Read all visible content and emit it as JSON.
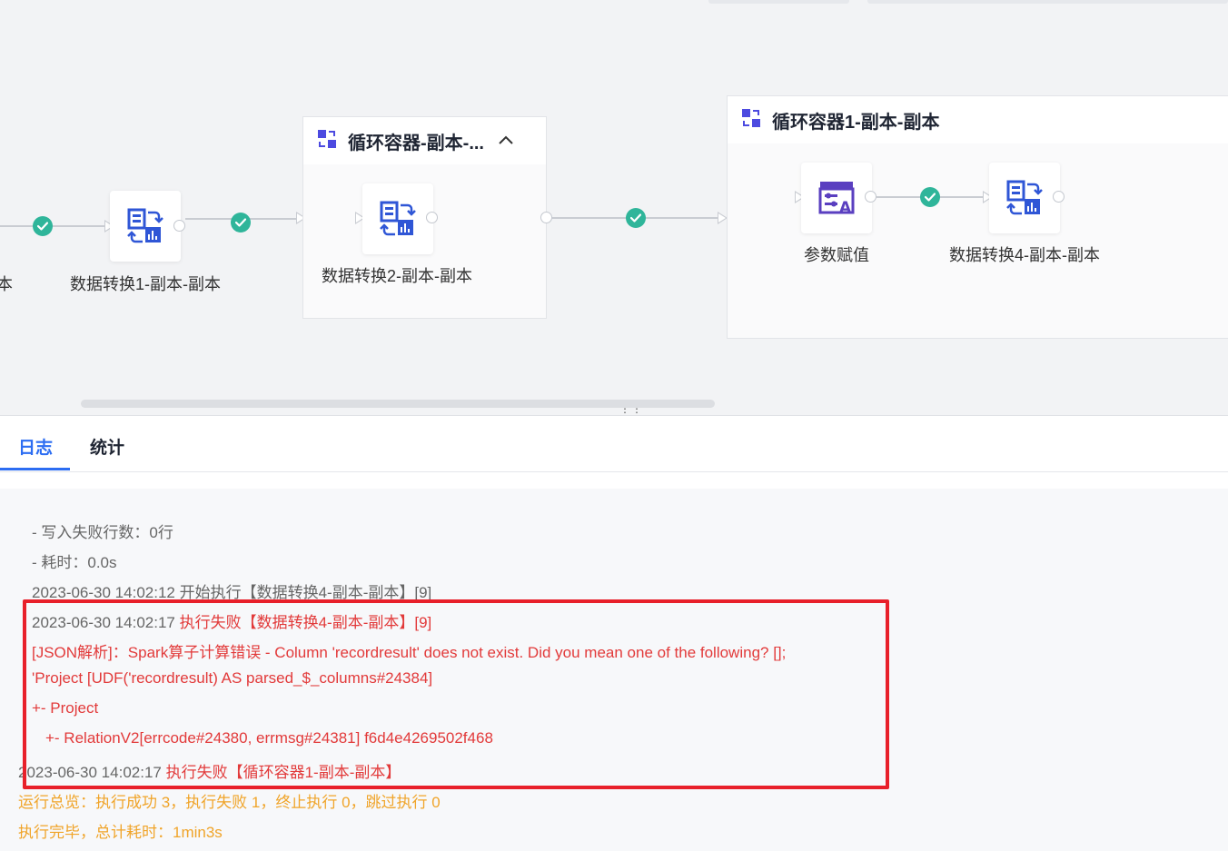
{
  "canvas": {
    "partial_label": "本",
    "nodes": {
      "transform1": "数据转换1-副本-副本",
      "transform2": "数据转换2-副本-副本",
      "param_assign": "参数赋值",
      "transform4": "数据转换4-副本-副本"
    },
    "containers": {
      "loop_container": "循环容器-副本-...",
      "loop_container1": "循环容器1-副本-副本"
    },
    "drag_handle": "⋮⋮"
  },
  "tabs": {
    "log": "日志",
    "stats": "统计"
  },
  "log": {
    "l1": "- 写入失败行数：0行",
    "l2": "- 耗时：0.0s",
    "l3_time": "2023-06-30 14:02:12",
    "l3_msg": "开始执行【数据转换4-副本-副本】[9]",
    "l4_time": "2023-06-30 14:02:17",
    "l4_msg": "执行失败【数据转换4-副本-副本】[9]",
    "l5": "[JSON解析]：Spark算子计算错误 - Column 'recordresult' does not exist. Did you mean one of the following? [];",
    "l6": "'Project [UDF('recordresult) AS parsed_$_columns#24384]",
    "l7": "+- Project",
    "l8": "+- RelationV2[errcode#24380, errmsg#24381] f6d4e4269502f468",
    "l9_time": "2023-06-30 14:02:17",
    "l9_msg": "执行失败【循环容器1-副本-副本】",
    "l10": "运行总览：执行成功 3，执行失败 1，终止执行 0，跳过执行 0",
    "l11": "执行完毕，总计耗时：1min3s"
  },
  "colors": {
    "accent": "#2c6df2",
    "success": "#2fb59a",
    "error": "#e23a3a",
    "warning": "#f0a429",
    "highlight_box": "#e8202a"
  }
}
